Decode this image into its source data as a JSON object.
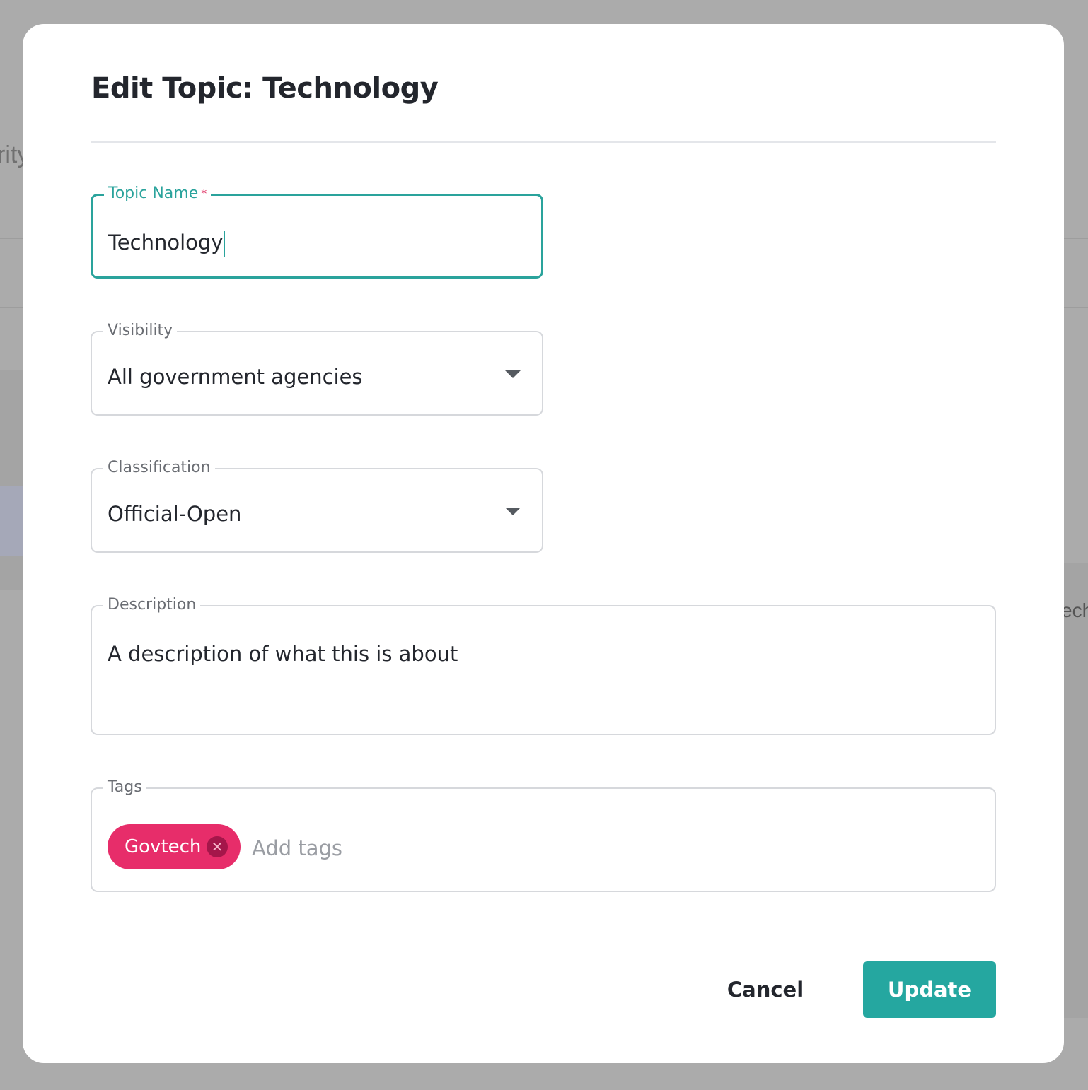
{
  "background": {
    "fragment_left": "rity",
    "fragment_right": "ech"
  },
  "dialog": {
    "title": "Edit Topic: Technology"
  },
  "fields": {
    "topic_name": {
      "label": "Topic Name",
      "required_mark": "*",
      "value": "Technology"
    },
    "visibility": {
      "label": "Visibility",
      "value": "All government agencies"
    },
    "classification": {
      "label": "Classification",
      "value": "Official-Open"
    },
    "description": {
      "label": "Description",
      "value": "A description of what this is about"
    },
    "tags": {
      "label": "Tags",
      "items": [
        {
          "label": "Govtech"
        }
      ],
      "placeholder": "Add tags"
    }
  },
  "actions": {
    "cancel_label": "Cancel",
    "update_label": "Update"
  },
  "colors": {
    "accent": "#25a7a0",
    "tag_chip": "#e72d6a",
    "required": "#e03163",
    "overlay": "#ababab"
  },
  "icons": {
    "dropdown": "chevron-down-icon",
    "tag_remove": "close-circle-icon"
  }
}
